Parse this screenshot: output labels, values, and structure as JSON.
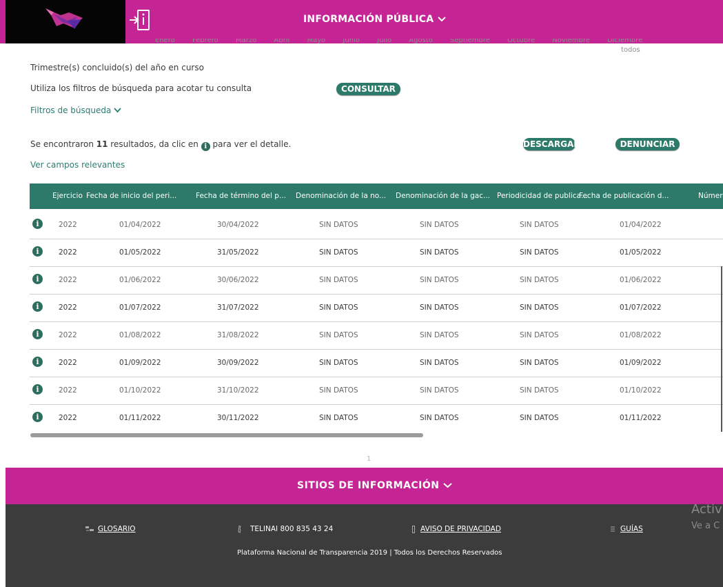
{
  "header": {
    "title": "INFORMACIÓN PÚBLICA",
    "months": [
      "Enero",
      "Febrero",
      "Marzo",
      "Abril",
      "Mayo",
      "Junio",
      "Julio",
      "Agosto",
      "Septiembre",
      "Octubre",
      "Noviembre",
      "Diciembre"
    ],
    "todos": "todos",
    "colors": {
      "brand": "#c42494",
      "accent": "#2d7a6a"
    }
  },
  "filters": {
    "trimestre_text": "Trimestre(s) concluido(s) del año en curso",
    "hint_text": "Utiliza los filtros de búsqueda para acotar tu consulta",
    "consultar_label": "CONSULTAR",
    "filtros_label": "Filtros de búsqueda"
  },
  "results": {
    "prefix": "Se encontraron ",
    "count": "11",
    "middle": " resultados, da clic en ",
    "suffix": " para ver el detalle.",
    "descargar_label": "DESCARGAR",
    "denunciar_label": "DENUNCIAR",
    "campos_label": "Ver campos relevantes"
  },
  "table": {
    "columns": [
      "Ejercicio",
      "Fecha de inicio del peri...",
      "Fecha de término del p...",
      "Denominación de la no...",
      "Denominación de la gac...",
      "Periodicidad de publica...",
      "Fecha de publicación d...",
      "Número"
    ],
    "rows": [
      [
        "2022",
        "01/04/2022",
        "30/04/2022",
        "SIN DATOS",
        "SIN DATOS",
        "SIN DATOS",
        "01/04/2022"
      ],
      [
        "2022",
        "01/05/2022",
        "31/05/2022",
        "SIN DATOS",
        "SIN DATOS",
        "SIN DATOS",
        "01/05/2022"
      ],
      [
        "2022",
        "01/06/2022",
        "30/06/2022",
        "SIN DATOS",
        "SIN DATOS",
        "SIN DATOS",
        "01/06/2022"
      ],
      [
        "2022",
        "01/07/2022",
        "31/07/2022",
        "SIN DATOS",
        "SIN DATOS",
        "SIN DATOS",
        "01/07/2022"
      ],
      [
        "2022",
        "01/08/2022",
        "31/08/2022",
        "SIN DATOS",
        "SIN DATOS",
        "SIN DATOS",
        "01/08/2022"
      ],
      [
        "2022",
        "01/09/2022",
        "30/09/2022",
        "SIN DATOS",
        "SIN DATOS",
        "SIN DATOS",
        "01/09/2022"
      ],
      [
        "2022",
        "01/10/2022",
        "31/10/2022",
        "SIN DATOS",
        "SIN DATOS",
        "SIN DATOS",
        "01/10/2022"
      ],
      [
        "2022",
        "01/11/2022",
        "30/11/2022",
        "SIN DATOS",
        "SIN DATOS",
        "SIN DATOS",
        "01/11/2022"
      ]
    ]
  },
  "pager": {
    "page": "1"
  },
  "footer": {
    "title": "SITIOS DE INFORMACIÓN",
    "glosario": "GLOSARIO",
    "telinai": "TELINAI 800 835 43 24",
    "aviso": "AVISO DE PRIVACIDAD",
    "guias": "GUÍAS",
    "copyright": "Plataforma Nacional de Transparencia 2019 | Todos los Derechos Reservados"
  },
  "watermark": {
    "line1": "Activ",
    "line2": "Ve a C"
  }
}
